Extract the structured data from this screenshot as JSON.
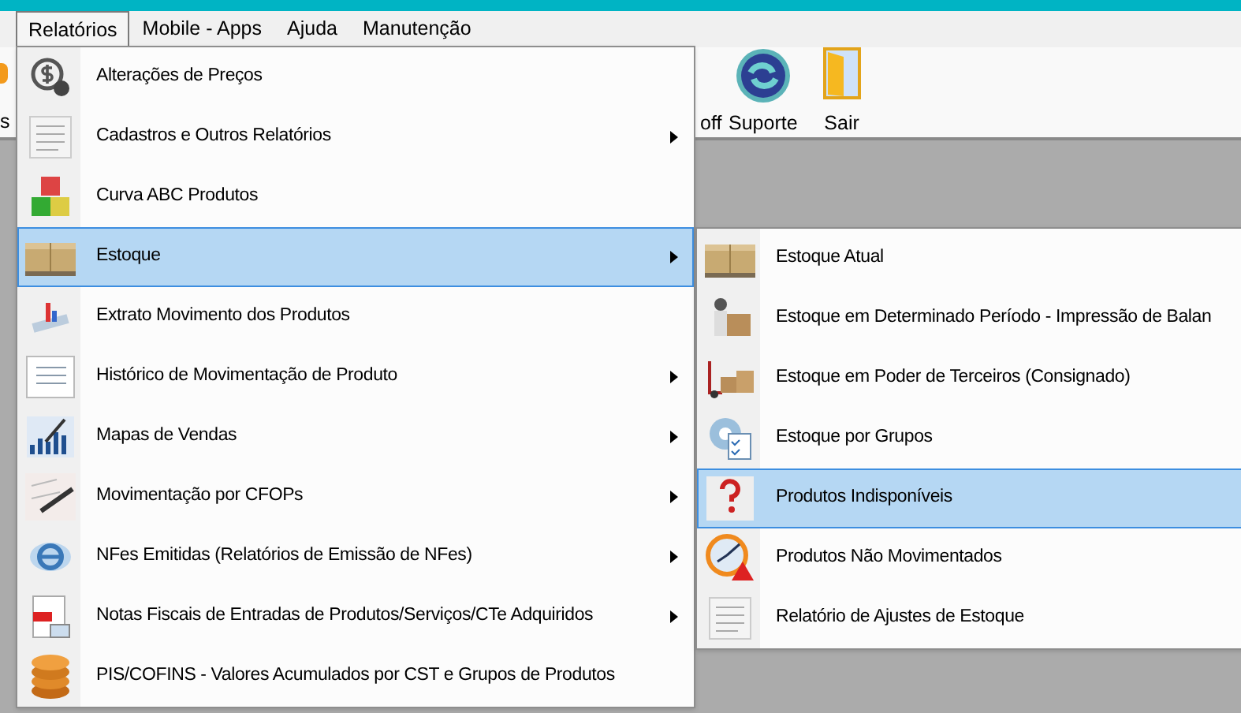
{
  "menubar": [
    {
      "label": "Relatórios",
      "selected": true
    },
    {
      "label": "Mobile - Apps",
      "selected": false
    },
    {
      "label": "Ajuda",
      "selected": false
    },
    {
      "label": "Manutenção",
      "selected": false
    }
  ],
  "toolbar": [
    {
      "label": "s",
      "kind": "partial-left"
    },
    {
      "label": "off",
      "kind": "partial-right"
    },
    {
      "label": "Suporte",
      "kind": "support"
    },
    {
      "label": "Sair",
      "kind": "exit"
    }
  ],
  "menu": [
    {
      "label": "Alterações de Preços",
      "submenu": false,
      "selected": false
    },
    {
      "label": "Cadastros e Outros Relatórios",
      "submenu": true,
      "selected": false
    },
    {
      "label": "Curva ABC Produtos",
      "submenu": false,
      "selected": false
    },
    {
      "label": "Estoque",
      "submenu": true,
      "selected": true
    },
    {
      "label": "Extrato Movimento dos Produtos",
      "submenu": false,
      "selected": false
    },
    {
      "label": "Histórico de Movimentação de Produto",
      "submenu": true,
      "selected": false
    },
    {
      "label": "Mapas de Vendas",
      "submenu": true,
      "selected": false
    },
    {
      "label": "Movimentação por CFOPs",
      "submenu": true,
      "selected": false
    },
    {
      "label": "NFes Emitidas (Relatórios de Emissão de NFes)",
      "submenu": true,
      "selected": false
    },
    {
      "label": "Notas Fiscais de Entradas de Produtos/Serviços/CTe Adquiridos",
      "submenu": true,
      "selected": false
    },
    {
      "label": "PIS/COFINS - Valores Acumulados por CST e Grupos de Produtos",
      "submenu": false,
      "selected": false
    }
  ],
  "submenu": [
    {
      "label": "Estoque Atual",
      "selected": false
    },
    {
      "label": "Estoque em Determinado Período - Impressão de Balan",
      "selected": false
    },
    {
      "label": "Estoque em Poder de Terceiros (Consignado)",
      "selected": false
    },
    {
      "label": "Estoque por Grupos",
      "selected": false
    },
    {
      "label": "Produtos Indisponíveis",
      "selected": true
    },
    {
      "label": "Produtos Não Movimentados",
      "selected": false
    },
    {
      "label": "Relatório de Ajustes de Estoque",
      "selected": false
    }
  ]
}
